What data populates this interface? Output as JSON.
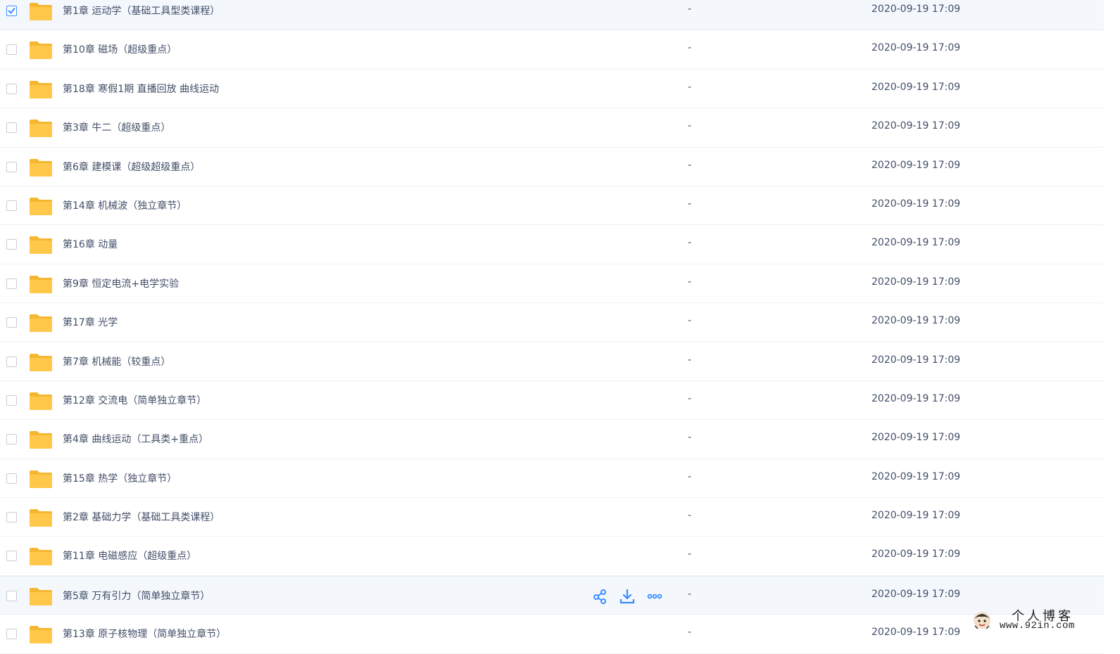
{
  "files": [
    {
      "name": "第1章 运动学（基础工具型类课程）",
      "size": "-",
      "date": "2020-09-19 17:09",
      "checked": true
    },
    {
      "name": "第10章 磁场（超级重点）",
      "size": "-",
      "date": "2020-09-19 17:09",
      "checked": false
    },
    {
      "name": "第18章 寒假1期 直播回放 曲线运动",
      "size": "-",
      "date": "2020-09-19 17:09",
      "checked": false
    },
    {
      "name": "第3章 牛二（超级重点）",
      "size": "-",
      "date": "2020-09-19 17:09",
      "checked": false
    },
    {
      "name": "第6章 建模课（超级超级重点）",
      "size": "-",
      "date": "2020-09-19 17:09",
      "checked": false
    },
    {
      "name": "第14章 机械波（独立章节）",
      "size": "-",
      "date": "2020-09-19 17:09",
      "checked": false
    },
    {
      "name": "第16章 动量",
      "size": "-",
      "date": "2020-09-19 17:09",
      "checked": false
    },
    {
      "name": "第9章 恒定电流+电学实验",
      "size": "-",
      "date": "2020-09-19 17:09",
      "checked": false
    },
    {
      "name": "第17章 光学",
      "size": "-",
      "date": "2020-09-19 17:09",
      "checked": false
    },
    {
      "name": "第7章 机械能（较重点）",
      "size": "-",
      "date": "2020-09-19 17:09",
      "checked": false
    },
    {
      "name": "第12章 交流电（简单独立章节）",
      "size": "-",
      "date": "2020-09-19 17:09",
      "checked": false
    },
    {
      "name": "第4章 曲线运动（工具类+重点）",
      "size": "-",
      "date": "2020-09-19 17:09",
      "checked": false
    },
    {
      "name": "第15章 热学（独立章节）",
      "size": "-",
      "date": "2020-09-19 17:09",
      "checked": false
    },
    {
      "name": "第2章 基础力学（基础工具类课程）",
      "size": "-",
      "date": "2020-09-19 17:09",
      "checked": false
    },
    {
      "name": "第11章 电磁感应（超级重点）",
      "size": "-",
      "date": "2020-09-19 17:09",
      "checked": false
    },
    {
      "name": "第5章 万有引力（简单独立章节）",
      "size": "-",
      "date": "2020-09-19 17:09",
      "checked": false,
      "hovered": true
    },
    {
      "name": "第13章 原子核物理（简单独立章节）",
      "size": "-",
      "date": "2020-09-19 17:09",
      "checked": false
    }
  ],
  "row_actions": {
    "share_icon": "share-icon",
    "download_icon": "download-icon",
    "more_icon": "more-icon"
  },
  "watermark": {
    "title": "个人博客",
    "url": "www.92in.com"
  },
  "colors": {
    "accent": "#3b8cff",
    "folder": "#ffc84a",
    "text": "#424e67",
    "selected_bg": "#f4f8fd"
  }
}
